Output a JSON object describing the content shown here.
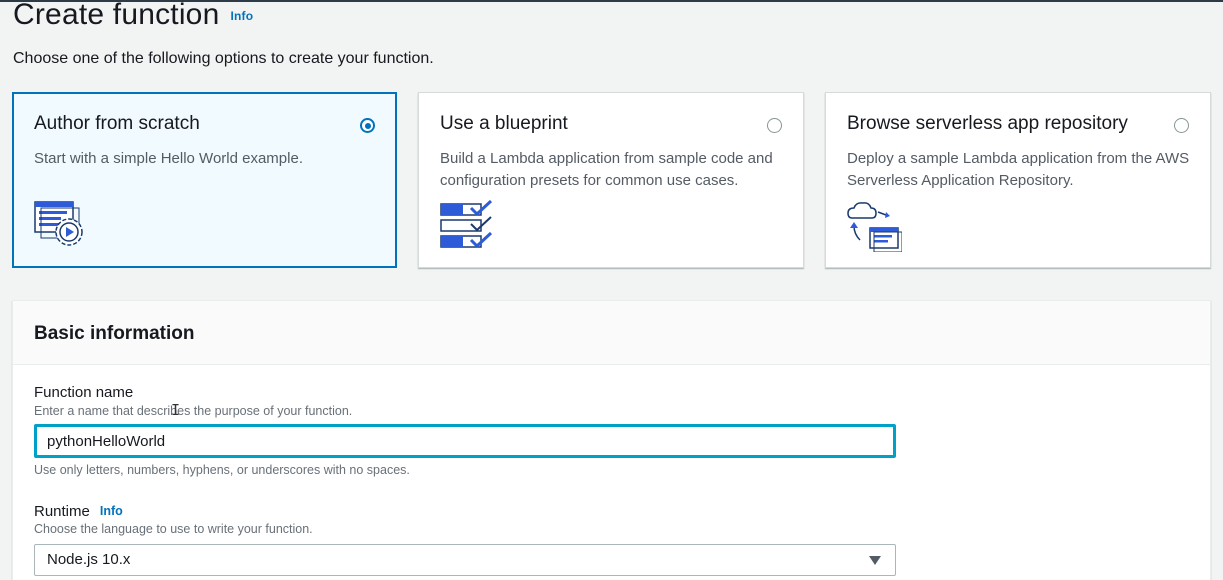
{
  "page": {
    "title": "Create function",
    "title_info": "Info",
    "subtitle": "Choose one of the following options to create your function."
  },
  "options": [
    {
      "title": "Author from scratch",
      "description": "Start with a simple Hello World example.",
      "selected": true,
      "icon": "code-gear-icon"
    },
    {
      "title": "Use a blueprint",
      "description": "Build a Lambda application from sample code and configuration presets for common use cases.",
      "selected": false,
      "icon": "blueprint-checklist-icon"
    },
    {
      "title": "Browse serverless app repository",
      "description": "Deploy a sample Lambda application from the AWS Serverless Application Repository.",
      "selected": false,
      "icon": "cloud-repository-icon"
    }
  ],
  "basic_info": {
    "header": "Basic information",
    "function_name": {
      "label": "Function name",
      "description": "Enter a name that describes the purpose of your function.",
      "value": "pythonHelloWorld",
      "hint": "Use only letters, numbers, hyphens, or underscores with no spaces."
    },
    "runtime": {
      "label": "Runtime",
      "info": "Info",
      "description": "Choose the language to use to write your function.",
      "value": "Node.js 10.x"
    }
  },
  "colors": {
    "accent": "#0073bb",
    "focus": "#00a1c9",
    "selected_bg": "#f1faff"
  }
}
